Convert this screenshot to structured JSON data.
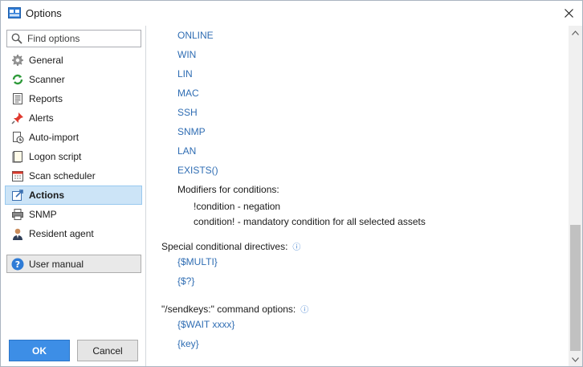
{
  "window": {
    "title": "Options"
  },
  "sidebar": {
    "search_placeholder": "Find options",
    "items": [
      {
        "label": "General",
        "icon": "gear-icon"
      },
      {
        "label": "Scanner",
        "icon": "scanner-icon"
      },
      {
        "label": "Reports",
        "icon": "report-icon"
      },
      {
        "label": "Alerts",
        "icon": "alert-pin-icon"
      },
      {
        "label": "Auto-import",
        "icon": "auto-import-icon"
      },
      {
        "label": "Logon script",
        "icon": "script-icon"
      },
      {
        "label": "Scan scheduler",
        "icon": "calendar-icon"
      },
      {
        "label": "Actions",
        "icon": "actions-icon",
        "selected": true
      },
      {
        "label": "SNMP",
        "icon": "printer-icon"
      },
      {
        "label": "Resident agent",
        "icon": "agent-icon"
      }
    ],
    "manual_label": "User manual",
    "ok_label": "OK",
    "cancel_label": "Cancel"
  },
  "content": {
    "conditions": [
      "ONLINE",
      "WIN",
      "LIN",
      "MAC",
      "SSH",
      "SNMP",
      "LAN",
      "EXISTS()"
    ],
    "modifiers_title": "Modifiers for conditions:",
    "modifiers": [
      "!condition - negation",
      "condition! - mandatory condition for all selected assets"
    ],
    "directives_title": "Special conditional directives:",
    "directives": [
      "{$MULTI}",
      "{$?}"
    ],
    "sendkeys_title": "\"/sendkeys:\" command options:",
    "sendkeys": [
      "{$WAIT xxxx}",
      "{key}"
    ],
    "info_glyph": "ⓘ"
  },
  "colors": {
    "link": "#2f6db3",
    "selection": "#cce4f7",
    "ok_button": "#3d8ee6"
  }
}
